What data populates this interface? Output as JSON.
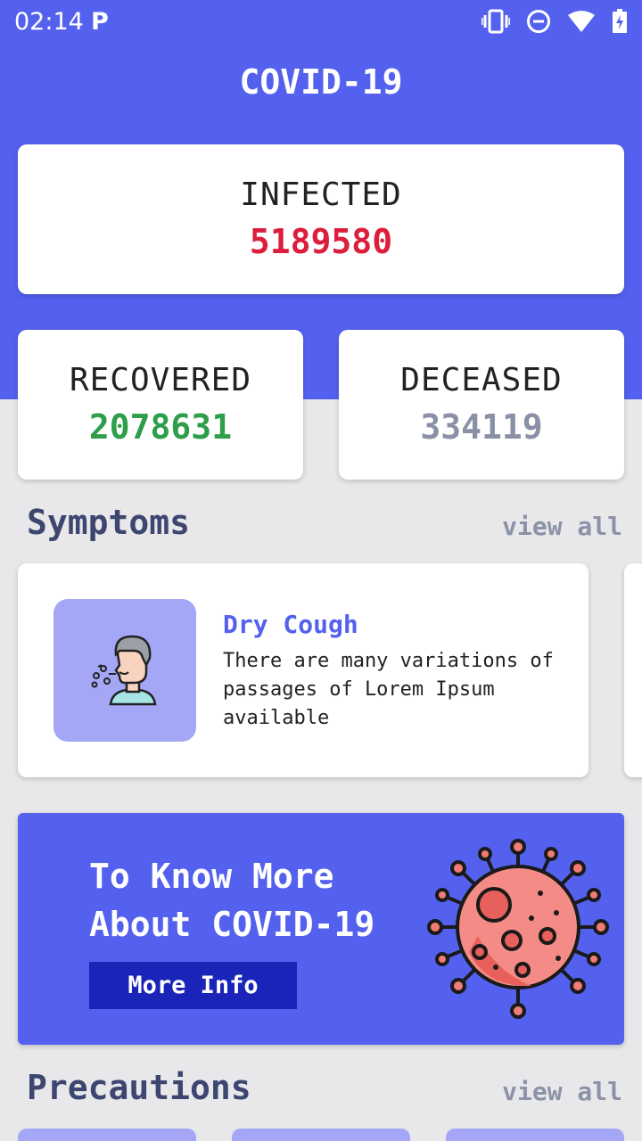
{
  "status_bar": {
    "time": "02:14",
    "app_indicator": "P",
    "icons": [
      "vibrate-icon",
      "do-not-disturb-icon",
      "wifi-icon",
      "battery-charging-icon"
    ]
  },
  "header": {
    "title": "COVID-19"
  },
  "stats": {
    "infected": {
      "label": "INFECTED",
      "value": "5189580",
      "color": "#dc1e3c"
    },
    "recovered": {
      "label": "RECOVERED",
      "value": "2078631",
      "color": "#2f9e4a"
    },
    "deceased": {
      "label": "DECEASED",
      "value": "334119",
      "color": "#8a90a6"
    }
  },
  "symptoms": {
    "title": "Symptoms",
    "view_all": "view all",
    "items": [
      {
        "title": "Dry Cough",
        "description": "There are many variations of passages of Lorem Ipsum available",
        "icon": "coughing-person-icon"
      }
    ]
  },
  "banner": {
    "title": "To Know More About COVID-19",
    "button_label": "More Info",
    "icon": "virus-icon"
  },
  "precautions": {
    "title": "Precautions",
    "view_all": "view all"
  },
  "colors": {
    "primary": "#5461ee",
    "dark_button": "#1a24b8",
    "icon_box": "#a3a7f5",
    "heading": "#3d4670"
  }
}
